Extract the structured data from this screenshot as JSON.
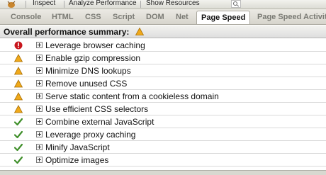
{
  "toolbar": {
    "items": [
      "Inspect",
      "Analyze Performance",
      "Show Resources"
    ]
  },
  "tabs": [
    {
      "label": "Console",
      "active": false
    },
    {
      "label": "HTML",
      "active": false
    },
    {
      "label": "CSS",
      "active": false
    },
    {
      "label": "Script",
      "active": false
    },
    {
      "label": "DOM",
      "active": false
    },
    {
      "label": "Net",
      "active": false
    },
    {
      "label": "Page Speed",
      "active": true
    },
    {
      "label": "Page Speed Activity",
      "active": false
    }
  ],
  "summary": {
    "label": "Overall performance summary:",
    "status": "warning"
  },
  "rules": [
    {
      "label": "Leverage browser caching",
      "status": "error"
    },
    {
      "label": "Enable gzip compression",
      "status": "warning"
    },
    {
      "label": "Minimize DNS lookups",
      "status": "warning"
    },
    {
      "label": "Remove unused CSS",
      "status": "warning"
    },
    {
      "label": "Serve static content from a cookieless domain",
      "status": "warning"
    },
    {
      "label": "Use efficient CSS selectors",
      "status": "warning"
    },
    {
      "label": "Combine external JavaScript",
      "status": "pass"
    },
    {
      "label": "Leverage proxy caching",
      "status": "pass"
    },
    {
      "label": "Minify JavaScript",
      "status": "pass"
    },
    {
      "label": "Optimize images",
      "status": "pass"
    }
  ],
  "colors": {
    "error": "#c8161d",
    "warning": "#f0a91a",
    "pass": "#3f8f2a"
  }
}
